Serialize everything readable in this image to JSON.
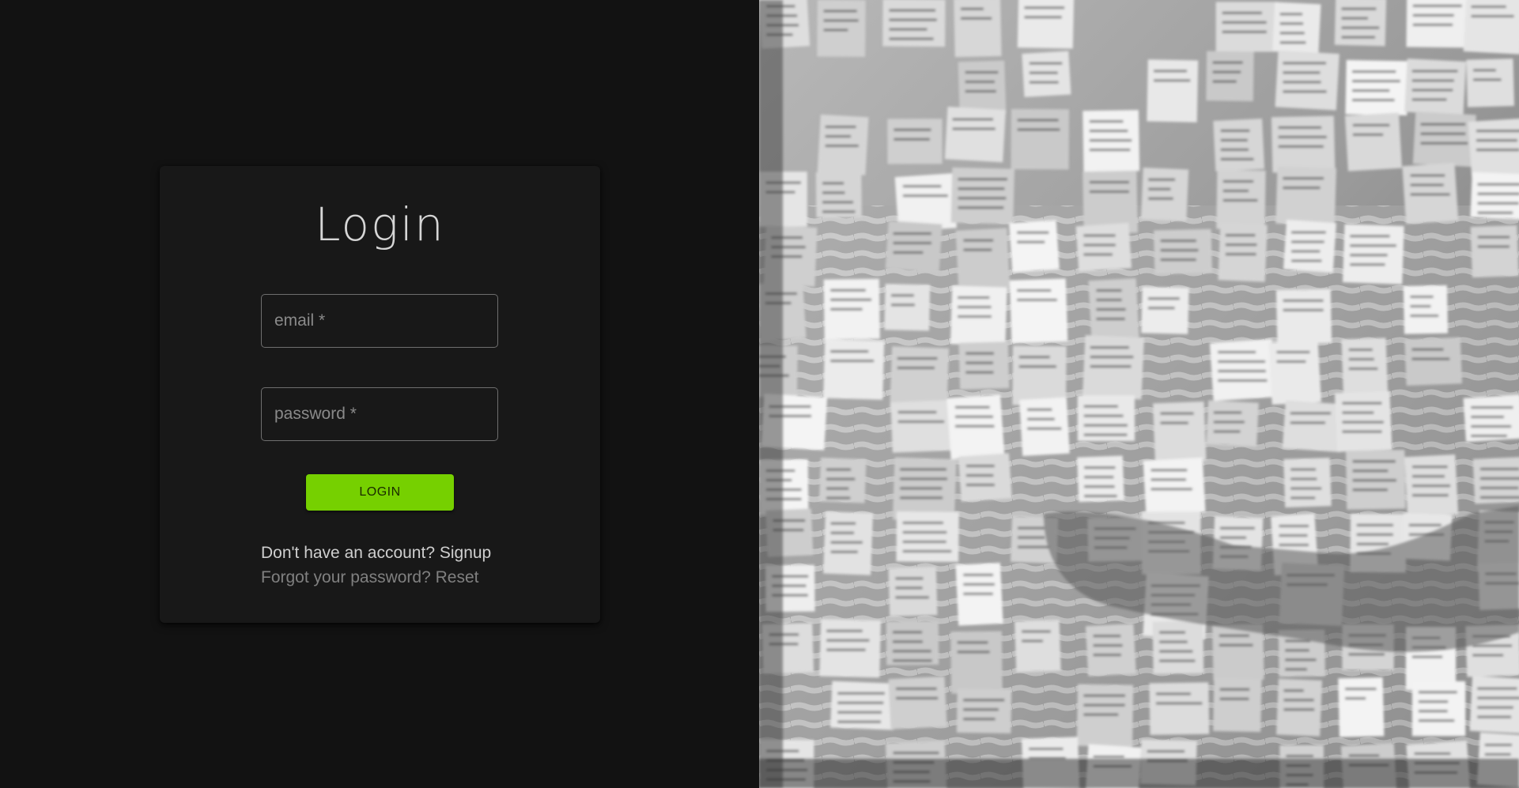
{
  "login": {
    "title": "Login",
    "email_placeholder": "email *",
    "password_placeholder": "password *",
    "button_label": "LOGIN",
    "signup_prompt": "Don't have an account?",
    "signup_link": "Signup",
    "reset_prompt": "Forgot your password?",
    "reset_link": "Reset"
  },
  "colors": {
    "background": "#121212",
    "card": "#181818",
    "accent": "#76d000"
  },
  "hero_image": {
    "description_icon": "sticky-notes-wall-image"
  }
}
